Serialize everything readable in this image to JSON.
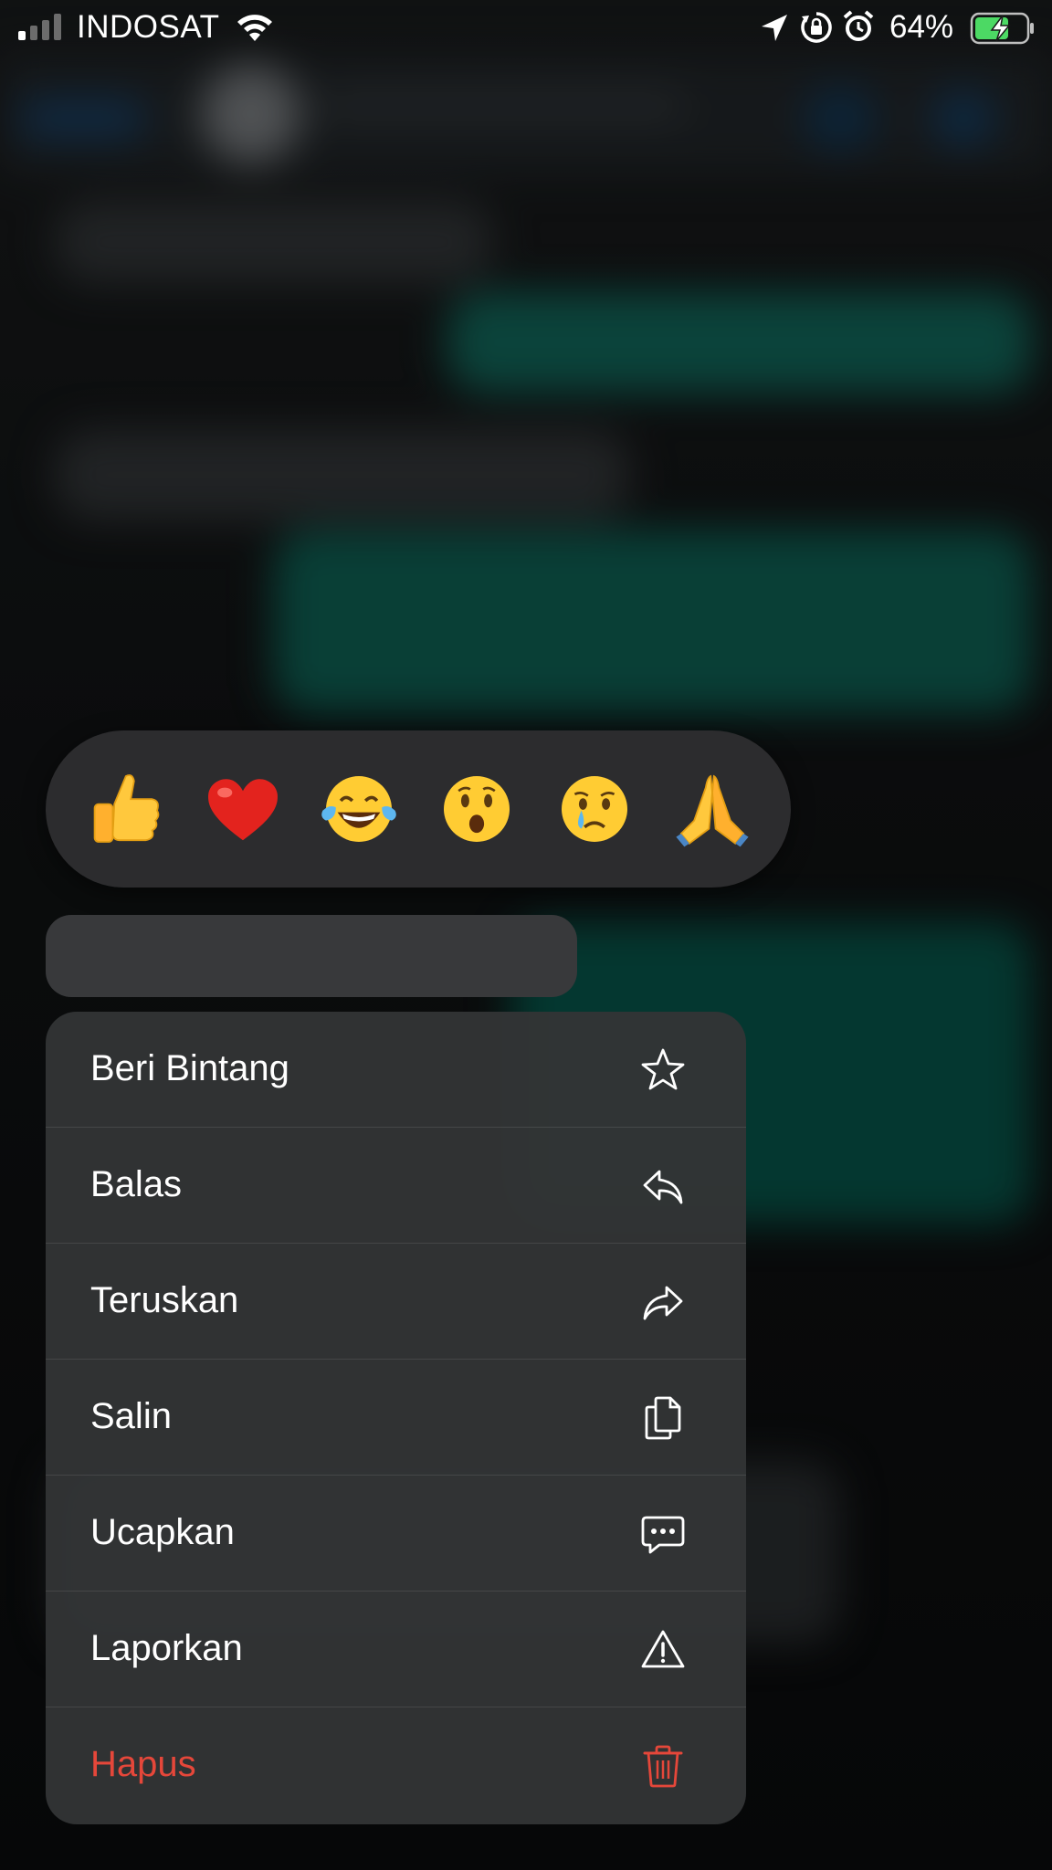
{
  "status_bar": {
    "carrier": "INDOSAT",
    "battery_percent": "64%",
    "signal_bars_active": 1,
    "signal_bars_total": 4,
    "battery_level": 0.64,
    "battery_charging": true
  },
  "reactions": [
    {
      "emoji": "thumbs-up",
      "label": "👍"
    },
    {
      "emoji": "red-heart",
      "label": "❤️"
    },
    {
      "emoji": "tears-of-joy",
      "label": "😂"
    },
    {
      "emoji": "surprised",
      "label": "😮"
    },
    {
      "emoji": "crying",
      "label": "😢"
    },
    {
      "emoji": "folded-hands",
      "label": "🙏"
    }
  ],
  "menu": {
    "items": [
      {
        "label": "Beri Bintang",
        "icon": "star-icon"
      },
      {
        "label": "Balas",
        "icon": "reply-icon"
      },
      {
        "label": "Teruskan",
        "icon": "forward-icon"
      },
      {
        "label": "Salin",
        "icon": "copy-icon"
      },
      {
        "label": "Ucapkan",
        "icon": "speech-bubble-icon"
      },
      {
        "label": "Laporkan",
        "icon": "warning-icon"
      },
      {
        "label": "Hapus",
        "icon": "trash-icon"
      }
    ]
  },
  "colors": {
    "destructive": "#e5473a",
    "menu_bg": "#323435",
    "reaction_bar_bg": "#2c2c2e",
    "battery_green": "#4cd964"
  }
}
